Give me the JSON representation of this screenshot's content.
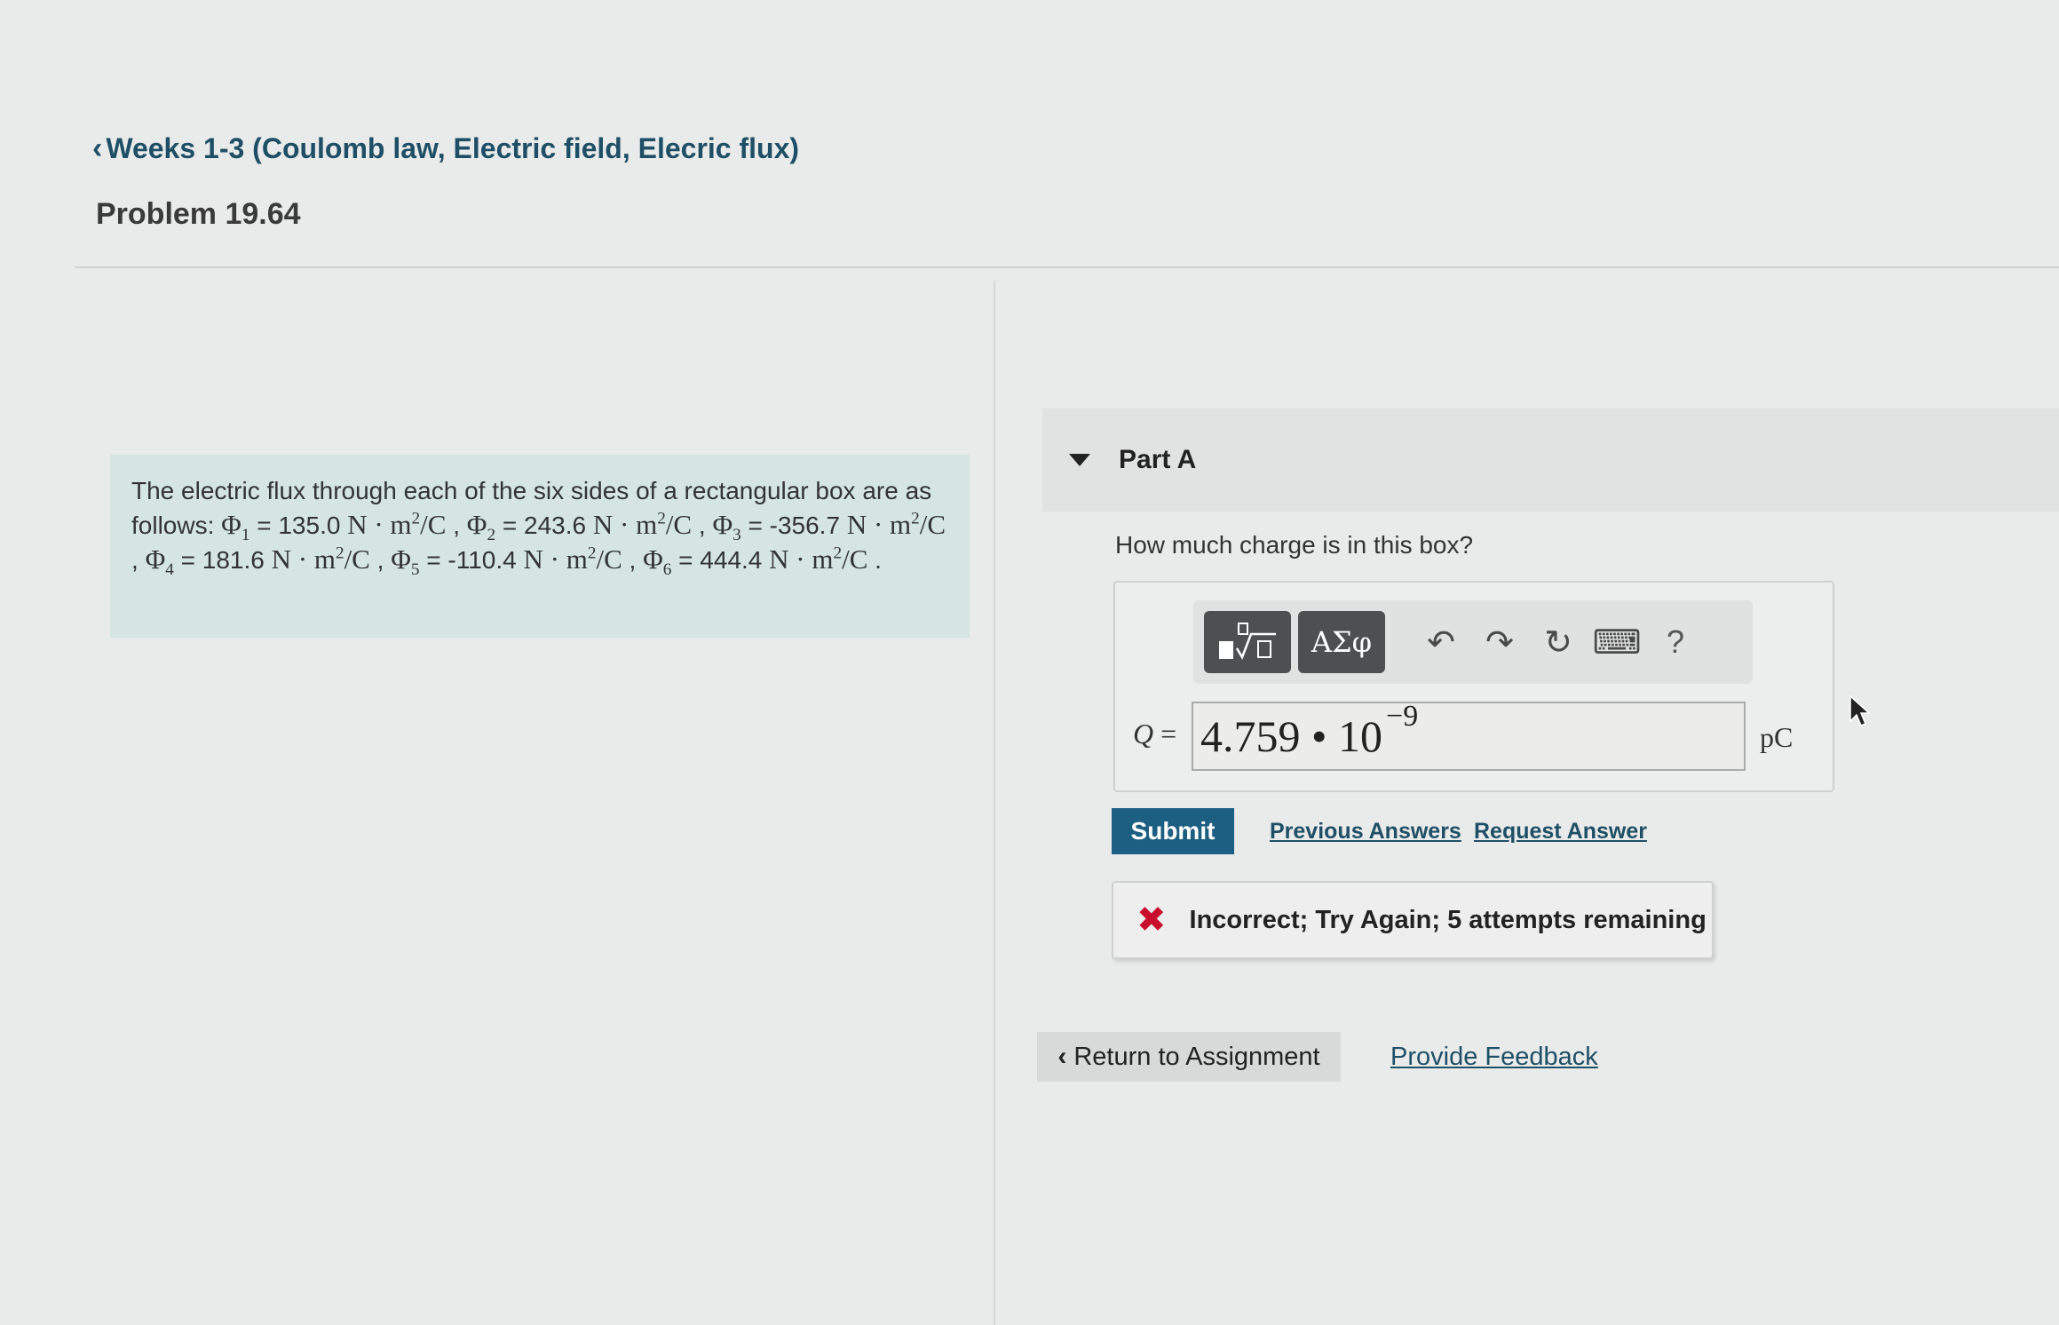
{
  "breadcrumb": {
    "label": "Weeks 1-3 (Coulomb law, Electric field, Elecric flux)"
  },
  "problem": {
    "title": "Problem 19.64",
    "intro": "The electric flux through each of the six sides of a rectangular box are as follows: ",
    "flux": [
      {
        "label": "Φ",
        "sub": "1",
        "value": "135.0"
      },
      {
        "label": "Φ",
        "sub": "2",
        "value": "243.6"
      },
      {
        "label": "Φ",
        "sub": "3",
        "value": "-356.7"
      },
      {
        "label": "Φ",
        "sub": "4",
        "value": "181.6"
      },
      {
        "label": "Φ",
        "sub": "5",
        "value": "-110.4"
      },
      {
        "label": "Φ",
        "sub": "6",
        "value": "444.4"
      }
    ],
    "unit_base": "N · m",
    "unit_exp": "2",
    "unit_tail": "/C"
  },
  "part": {
    "label": "Part A",
    "question": "How much charge is in this box?",
    "toolbar": {
      "templates_glyph": "▪ⁿ√▫",
      "symbols_label": "ΑΣφ",
      "undo_glyph": "↶",
      "redo_glyph": "↷",
      "reset_glyph": "↻",
      "keyboard_glyph": "⌨",
      "help_glyph": "?"
    },
    "variable": "Q",
    "equals": "=",
    "answer_mantissa": "4.759 • 10",
    "answer_exponent": "−9",
    "unit": "pC"
  },
  "actions": {
    "submit": "Submit",
    "previous_answers": "Previous Answers",
    "request_answer": "Request Answer"
  },
  "feedback": {
    "icon": "✖",
    "message": "Incorrect; Try Again; 5 attempts remaining"
  },
  "footer": {
    "return_label": "Return to Assignment",
    "provide_feedback": "Provide Feedback"
  },
  "colors": {
    "accent": "#1d5f82",
    "link": "#1f4f66",
    "error": "#c8102e",
    "problem_bg": "#d5e6e2"
  }
}
